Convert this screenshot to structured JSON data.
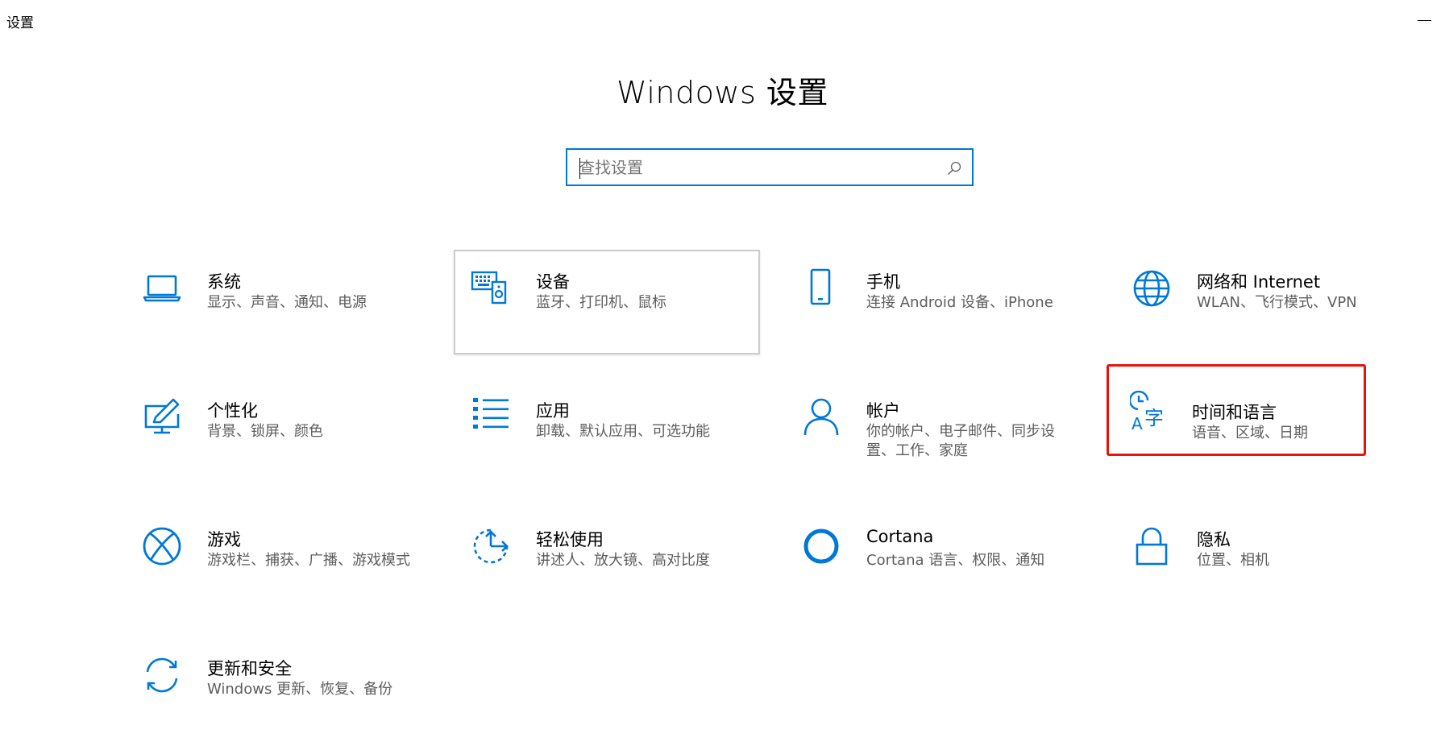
{
  "window": {
    "title": "设置"
  },
  "header": {
    "title": "Windows 设置"
  },
  "search": {
    "placeholder": "查找设置",
    "value": ""
  },
  "accent_color": "#0078d7",
  "highlight_color": "#e8140c",
  "tiles": [
    {
      "title": "系统",
      "desc": "显示、声音、通知、电源",
      "icon": "laptop-icon"
    },
    {
      "title": "设备",
      "desc": "蓝牙、打印机、鼠标",
      "icon": "devices-icon"
    },
    {
      "title": "手机",
      "desc": "连接 Android 设备、iPhone",
      "icon": "phone-icon"
    },
    {
      "title": "网络和 Internet",
      "desc": "WLAN、飞行模式、VPN",
      "icon": "globe-icon"
    },
    {
      "title": "个性化",
      "desc": "背景、锁屏、颜色",
      "icon": "personalization-icon"
    },
    {
      "title": "应用",
      "desc": "卸载、默认应用、可选功能",
      "icon": "apps-list-icon"
    },
    {
      "title": "帐户",
      "desc": "你的帐户、电子邮件、同步设置、工作、家庭",
      "icon": "person-icon"
    },
    {
      "title": "时间和语言",
      "desc": "语音、区域、日期",
      "icon": "time-language-icon"
    },
    {
      "title": "游戏",
      "desc": "游戏栏、捕获、广播、游戏模式",
      "icon": "xbox-icon"
    },
    {
      "title": "轻松使用",
      "desc": "讲述人、放大镜、高对比度",
      "icon": "ease-of-access-icon"
    },
    {
      "title": "Cortana",
      "desc": "Cortana 语言、权限、通知",
      "icon": "cortana-icon"
    },
    {
      "title": "隐私",
      "desc": "位置、相机",
      "icon": "lock-icon"
    },
    {
      "title": "更新和安全",
      "desc": "Windows 更新、恢复、备份",
      "icon": "sync-icon"
    }
  ]
}
